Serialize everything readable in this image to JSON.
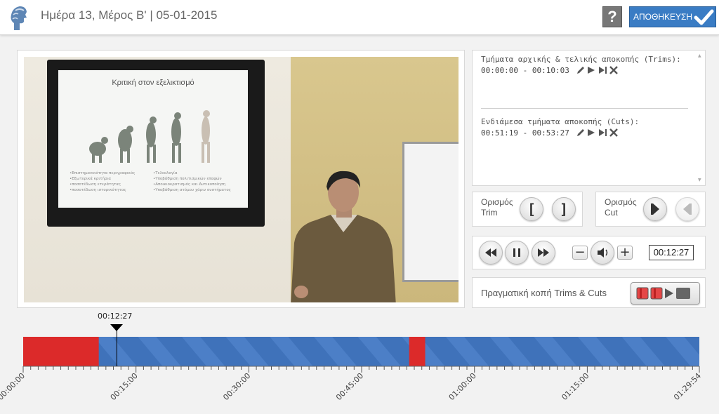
{
  "header": {
    "title": "Ημέρα 13, Μέρος Β' | 05-01-2015",
    "help_label": "?",
    "save_label": "ΑΠΟΘΗΚΕΥΣΗ"
  },
  "slide": {
    "title": "Κριτική στον εξελικτισμό",
    "bullets_left": [
      "•Επιστημονικότητα περιγραφικός",
      "•Εξωτερικά κριτήρια",
      "•ποσοτέδωση ετεράτητας",
      "•ποσοτέδωση ιστορικότητας"
    ],
    "bullets_right": [
      "•Τελεολογία",
      "•Υποβάθμιση πολιτισμικών επαφών",
      "•Αποικιοκρατισμός και Δυτικοποίηση",
      "•Υποβάθμιση ατόμου χάριν συστήματος"
    ]
  },
  "trims": {
    "label": "Τμήματα αρχικής & τελικής αποκοπής (Trims):",
    "rows": [
      {
        "range": "00:00:00 - 00:10:03"
      }
    ]
  },
  "cuts": {
    "label": "Ενδιάμεσα τμήματα αποκοπής (Cuts):",
    "rows": [
      {
        "range": "00:51:19 - 00:53:27"
      }
    ]
  },
  "trim_panel": {
    "label_line1": "Ορισμός",
    "label_line2": "Trim",
    "open_label": "[",
    "close_label": "]"
  },
  "cut_panel": {
    "label_line1": "Ορισμός",
    "label_line2": "Cut"
  },
  "player": {
    "time": "00:12:27",
    "volume_minus": "−",
    "volume_plus": "+"
  },
  "apply": {
    "label": "Πραγματική κοπή Trims & Cuts"
  },
  "timeline": {
    "current_label": "00:12:27",
    "total_seconds": 5394,
    "current_seconds": 747,
    "trims": [
      {
        "start": 0,
        "end": 603
      }
    ],
    "cuts": [
      {
        "start": 3079,
        "end": 3207
      }
    ],
    "tick_labels": [
      {
        "t": 0,
        "label": "00:00:00"
      },
      {
        "t": 900,
        "label": "00:15:00"
      },
      {
        "t": 1800,
        "label": "00:30:00"
      },
      {
        "t": 2700,
        "label": "00:45:00"
      },
      {
        "t": 3600,
        "label": "01:00:00"
      },
      {
        "t": 4500,
        "label": "01:15:00"
      },
      {
        "t": 5394,
        "label": "01:29:54"
      }
    ],
    "colors": {
      "track": "#3d6fb8",
      "stripe": "#4a7dc6",
      "trim_cut": "#dc2a2a",
      "playhead": "#000000"
    }
  }
}
